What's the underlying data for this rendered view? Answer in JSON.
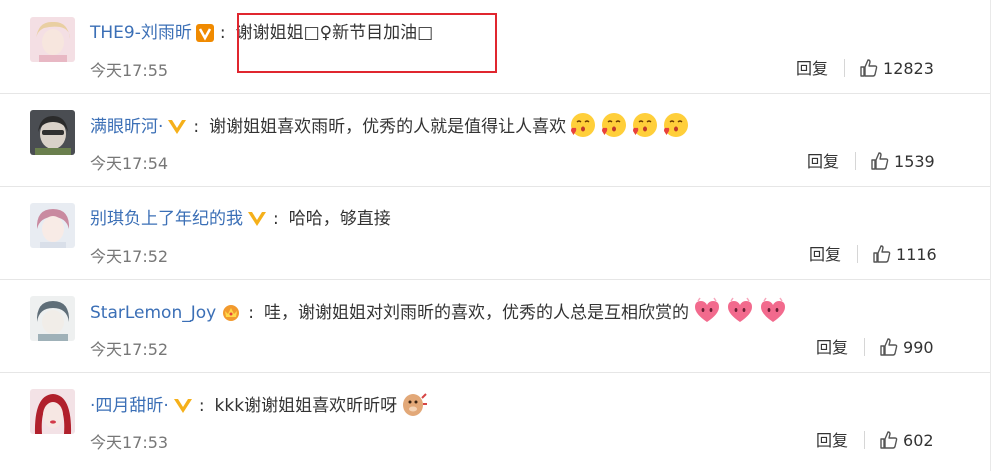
{
  "comments": [
    {
      "user": "THE9-刘雨昕",
      "badge": "orange",
      "text": "谢谢姐姐□♀新节目加油□",
      "emojis": [],
      "time": "今天17:55",
      "reply": "回复",
      "likes": "12823"
    },
    {
      "user": "满眼昕河·",
      "badge": "yellow",
      "text": "谢谢姐姐喜欢雨昕，优秀的人就是值得让人喜欢",
      "emojis": [
        "kiss",
        "kiss",
        "kiss",
        "kiss"
      ],
      "time": "今天17:54",
      "reply": "回复",
      "likes": "1539"
    },
    {
      "user": "别琪负上了年纪的我",
      "badge": "yellow",
      "text": "哈哈，够直接",
      "emojis": [],
      "time": "今天17:52",
      "reply": "回复",
      "likes": "1116"
    },
    {
      "user": "StarLemon_Joy",
      "badge": "crown",
      "text": "哇，谢谢姐姐对刘雨昕的喜欢，优秀的人总是互相欣赏的",
      "emojis": [
        "heart",
        "heart",
        "heart"
      ],
      "time": "今天17:52",
      "reply": "回复",
      "likes": "990"
    },
    {
      "user": "·四月甜昕·",
      "badge": "yellow",
      "text": "kkk谢谢姐姐喜欢昕昕呀",
      "emojis": [
        "doge"
      ],
      "time": "今天17:53",
      "reply": "回复",
      "likes": "602"
    }
  ],
  "colors": {
    "username": "#3b6fb6",
    "highlight_box": "#e0262f",
    "badge_yellow": "#f5b01a",
    "badge_orange": "#f08a00"
  }
}
